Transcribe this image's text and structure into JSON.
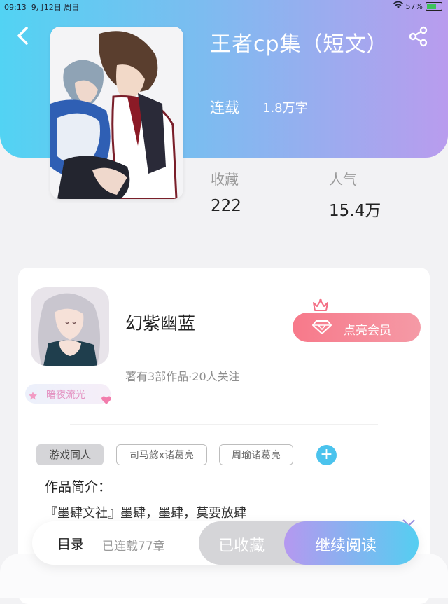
{
  "status_bar": {
    "time": "09:13",
    "date": "9月12日 周日",
    "battery_percent": "57%",
    "battery_level": 0.57
  },
  "book": {
    "title": "王者cp集（短文）",
    "serial_status": "连载",
    "word_count": "1.8万字",
    "favorites_label": "收藏",
    "favorites_value": "222",
    "popularity_label": "人气",
    "popularity_value": "15.4万"
  },
  "author": {
    "name": "幻紫幽蓝",
    "stats": "著有3部作品·20人关注",
    "badge": "暗夜流光",
    "member_button": "点亮会员"
  },
  "tags": [
    "游戏同人",
    "司马懿x诸葛亮",
    "周瑜诸葛亮"
  ],
  "intro": {
    "label": "作品简介：",
    "text": "『墨肆文社』墨肆，墨肆，莫要放肆"
  },
  "bottom_bar": {
    "catalog": "目录",
    "chapters": "已连载77章",
    "collected": "已收藏",
    "continue_reading": "继续阅读"
  },
  "icons": {
    "back": "chevron-left-icon",
    "share": "share-icon",
    "crown": "crown-icon",
    "diamond": "diamond-icon",
    "add": "plus-icon",
    "expand": "chevron-down-icon"
  },
  "colors": {
    "header_start": "#52d3f3",
    "header_end": "#b99cee",
    "member_pink": "#f7798a",
    "add_blue": "#4bc3ed"
  }
}
